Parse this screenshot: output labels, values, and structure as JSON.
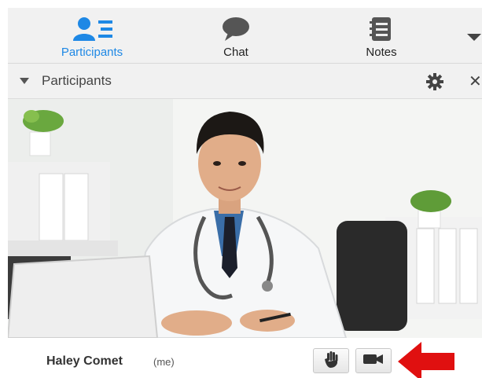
{
  "toolbar": {
    "tabs": [
      {
        "label": "Participants",
        "icon": "participants-icon",
        "active": true
      },
      {
        "label": "Chat",
        "icon": "chat-bubble-icon",
        "active": false
      },
      {
        "label": "Notes",
        "icon": "notes-icon",
        "active": false
      }
    ],
    "accent_color": "#1e88e5"
  },
  "panel": {
    "title": "Participants"
  },
  "participant": {
    "name": "Haley Comet",
    "me_tag": "(me)",
    "controls": [
      "raise-hand-icon",
      "video-camera-icon"
    ]
  },
  "annotation": {
    "arrow_color": "#e01010"
  }
}
